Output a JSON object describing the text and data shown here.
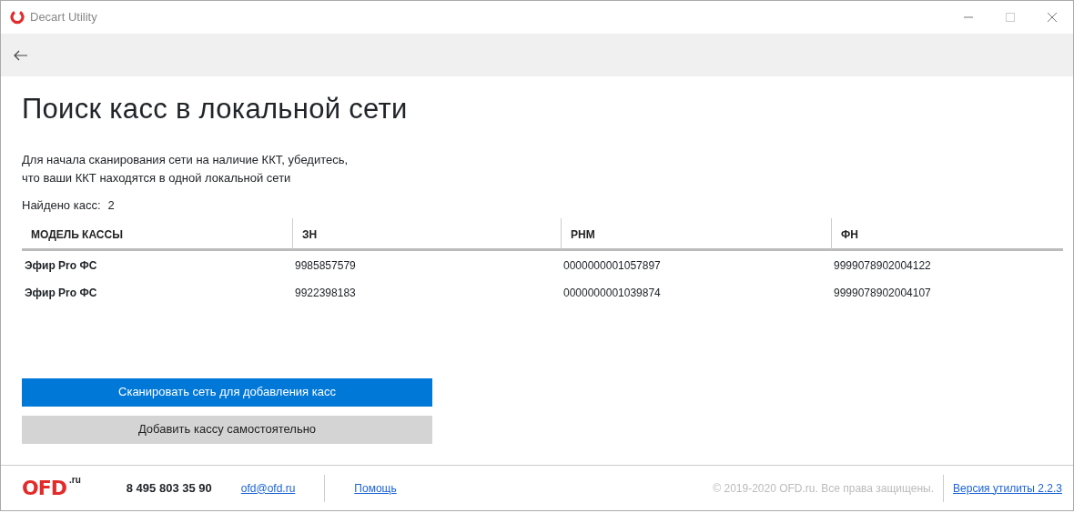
{
  "window": {
    "title": "Decart Utility"
  },
  "heading": "Поиск касс в локальной сети",
  "description": [
    "Для начала сканирования сети на наличие ККТ, убедитесь,",
    "что ваши ККТ находятся в одной локальной сети"
  ],
  "found": {
    "label": "Найдено касс:",
    "count": "2"
  },
  "table": {
    "columns": [
      "МОДЕЛЬ КАССЫ",
      "ЗН",
      "РНМ",
      "ФН"
    ],
    "rows": [
      [
        "Эфир Pro ФС",
        "9985857579",
        "0000000001057897",
        "9999078902004122"
      ],
      [
        "Эфир Pro ФС",
        "9922398183",
        "0000000001039874",
        "9999078902004107"
      ]
    ]
  },
  "buttons": [
    {
      "label": "Сканировать сеть для добавления касс",
      "kind": "primary"
    },
    {
      "label": "Добавить кассу самостоятельно",
      "kind": "secondary"
    }
  ],
  "footer": {
    "logo": "OFD",
    "logo_suffix": ".ru",
    "phone": "8 495 803 35 90",
    "email": "ofd@ofd.ru",
    "help": "Помощь",
    "copyright": "© 2019-2020 OFD.ru. Все права защищены.",
    "version": "Версия утилиты 2.2.3"
  }
}
